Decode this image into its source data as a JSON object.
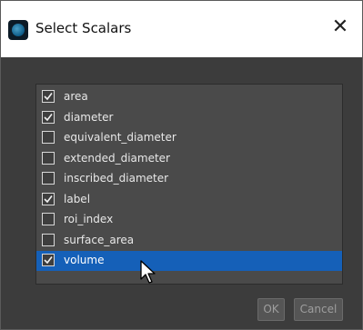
{
  "window": {
    "title": "Select Scalars",
    "close_glyph": "✕"
  },
  "scalars": [
    {
      "label": "area",
      "checked": true,
      "selected": false
    },
    {
      "label": "diameter",
      "checked": true,
      "selected": false
    },
    {
      "label": "equivalent_diameter",
      "checked": false,
      "selected": false
    },
    {
      "label": "extended_diameter",
      "checked": false,
      "selected": false
    },
    {
      "label": "inscribed_diameter",
      "checked": false,
      "selected": false
    },
    {
      "label": "label",
      "checked": true,
      "selected": false
    },
    {
      "label": "roi_index",
      "checked": false,
      "selected": false
    },
    {
      "label": "surface_area",
      "checked": false,
      "selected": false
    },
    {
      "label": "volume",
      "checked": true,
      "selected": true
    }
  ],
  "buttons": {
    "ok": "OK",
    "cancel": "Cancel"
  },
  "colors": {
    "selection": "#1560b8",
    "dialog_bg": "#3c3c3c",
    "list_bg": "#4a4a4a"
  }
}
